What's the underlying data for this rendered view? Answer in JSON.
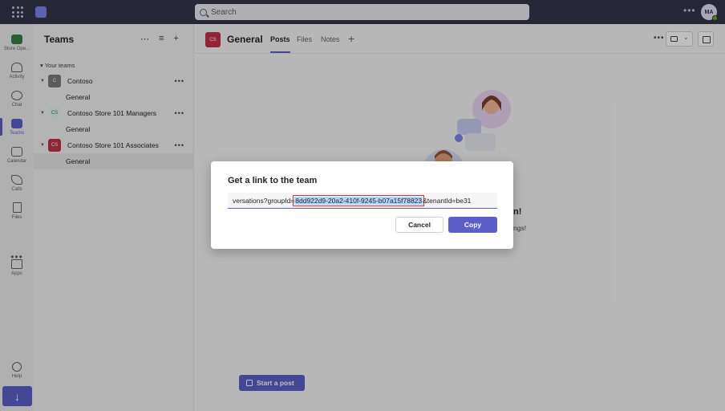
{
  "topbar": {
    "search_placeholder": "Search",
    "avatar_initials": "MA"
  },
  "rail": {
    "items": [
      {
        "label": "Store Ope..."
      },
      {
        "label": "Activity"
      },
      {
        "label": "Chat"
      },
      {
        "label": "Teams"
      },
      {
        "label": "Calendar"
      },
      {
        "label": "Calls"
      },
      {
        "label": "Files"
      },
      {
        "label": "Apps"
      },
      {
        "label": "Help"
      }
    ]
  },
  "teams_panel": {
    "title": "Teams",
    "section_label": "Your teams",
    "teams": [
      {
        "name": "Contoso",
        "avatar": "C",
        "color": "#7a7a7a",
        "channel": "General"
      },
      {
        "name": "Contoso Store 101 Managers",
        "avatar": "CS",
        "color": "#e6f2ec",
        "channel": "General"
      },
      {
        "name": "Contoso Store 101 Associates",
        "avatar": "CS",
        "color": "#c4314b",
        "channel": "General"
      }
    ]
  },
  "main": {
    "channel_avatar": "CS",
    "channel_name": "General",
    "tabs": [
      {
        "label": "Posts"
      },
      {
        "label": "Files"
      },
      {
        "label": "Notes"
      }
    ],
    "behind_heading_fragment": "n!",
    "behind_sub_fragment": "ngs!",
    "start_post_label": "Start a post"
  },
  "dialog": {
    "title": "Get a link to the team",
    "link_prefix": "versations?groupId=",
    "link_selected": "8dd922d9-20a2-410f-9245-b07a15f78823",
    "link_suffix": "&tenantId=be31",
    "cancel_label": "Cancel",
    "copy_label": "Copy"
  },
  "colors": {
    "accent": "#5b5fc7",
    "topbar": "#33344a",
    "highlight_box": "#d13438"
  }
}
